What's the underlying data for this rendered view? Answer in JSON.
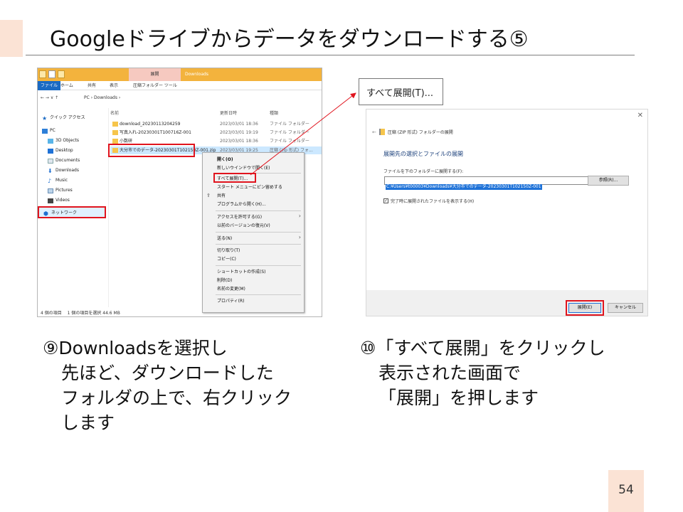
{
  "slide": {
    "title": "Googleドライブからデータをダウンロードする⑤",
    "page_number": "54"
  },
  "explorer": {
    "tool_tab": "展開",
    "window_title": "Downloads",
    "ribbon_tabs": [
      "ファイル",
      "ホーム",
      "共有",
      "表示",
      "圧縮フォルダー ツール"
    ],
    "address_nav": "← → ∨ ↑",
    "address_path": "PC › Downloads ›",
    "columns": {
      "name": "名前",
      "date": "更新日時",
      "type": "種類"
    },
    "sidebar": [
      {
        "label": "クイック アクセス",
        "icon": "star-icon"
      },
      {
        "label": "PC",
        "icon": "pc-icon"
      },
      {
        "label": "3D Objects",
        "icon": "3d-objects-icon"
      },
      {
        "label": "Desktop",
        "icon": "desktop-icon"
      },
      {
        "label": "Documents",
        "icon": "documents-icon"
      },
      {
        "label": "Downloads",
        "icon": "download-icon"
      },
      {
        "label": "Music",
        "icon": "music-icon"
      },
      {
        "label": "Pictures",
        "icon": "pictures-icon"
      },
      {
        "label": "Videos",
        "icon": "videos-icon"
      },
      {
        "label": "ネットワーク",
        "icon": "network-icon"
      }
    ],
    "files": [
      {
        "name": "download_20230113204259",
        "date": "2023/03/01 18:36",
        "type": "ファイル フォルダー"
      },
      {
        "name": "写真入れ-20230301T100716Z-001",
        "date": "2023/03/01 19:19",
        "type": "ファイル フォルダー"
      },
      {
        "name": "小数研",
        "date": "2023/03/01 18:36",
        "type": "ファイル フォルダー"
      },
      {
        "name": "大分市でのデータ-20230301T102150Z-001.zip",
        "date": "2023/03/01 19:25",
        "type": "圧縮 (zip 形式) フォ..."
      }
    ],
    "status": "4 個の項目　 1 個の項目を選択 44.6 MB"
  },
  "context_menu": {
    "items": [
      "開く(O)",
      "新しいウインドウで開く(E)",
      "すべて展開(T)...",
      "スタート メニューにピン留めする",
      "共有",
      "プログラムから開く(H)...",
      "アクセスを許可する(G)",
      "以前のバージョンの復元(V)",
      "送る(N)",
      "切り取り(T)",
      "コピー(C)",
      "ショートカットの作成(S)",
      "削除(D)",
      "名前の変更(M)",
      "プロパティ(R)"
    ]
  },
  "callout": {
    "label": "すべて展開(T)..."
  },
  "dialog": {
    "header": "圧縮 (ZIP 形式) フォルダーの展開",
    "subtitle": "展開先の選択とファイルの展開",
    "path_label": "ファイルを下のフォルダーに展開する(F):",
    "path_value": "C:¥Users¥t00003¥Downloads¥大分市でのデータ-20230301T102150Z-001",
    "browse_label": "参照(R)...",
    "checkbox_label": "完了時に展開されたファイルを表示する(H)",
    "checkbox_checked": true,
    "extract_label": "展開(E)",
    "cancel_label": "キャンセル"
  },
  "steps": {
    "step9": [
      "⑨Downloadsを選択し",
      "先ほど、ダウンロードした",
      "フォルダの上で、右クリック",
      "します"
    ],
    "step10": [
      "⑩「すべて展開」をクリックし",
      "表示された画面で",
      "「展開」を押します"
    ]
  },
  "colors": {
    "accent_block": "#fbe3d5",
    "highlight_red": "#e0141e",
    "explorer_titlebar": "#f3b33d",
    "selection_blue": "#1e72d8"
  }
}
